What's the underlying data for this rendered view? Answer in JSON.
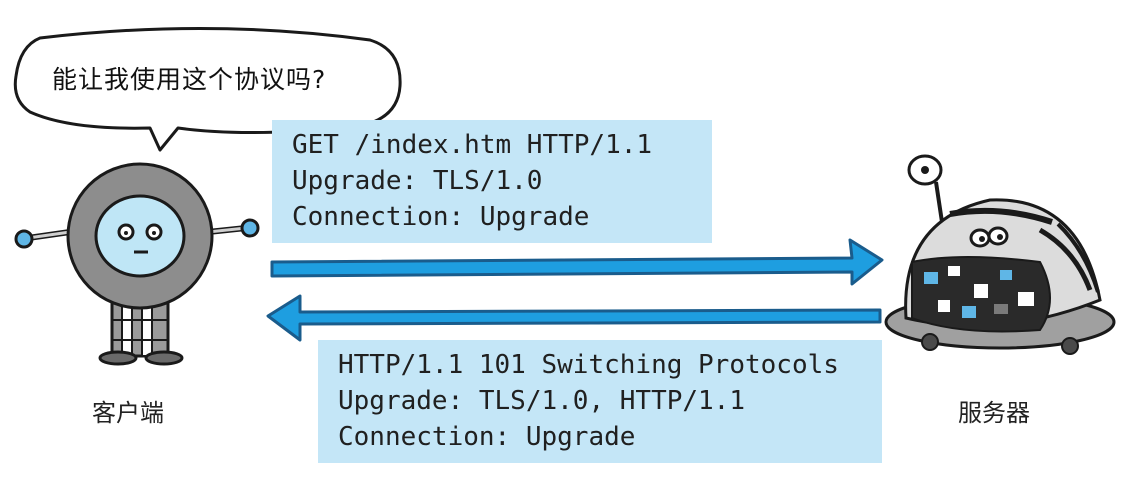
{
  "speech_bubble": {
    "text": "能让我使用这个协议吗?"
  },
  "request": {
    "lines": [
      "GET /index.htm HTTP/1.1",
      "Upgrade: TLS/1.0",
      "Connection: Upgrade"
    ]
  },
  "response": {
    "lines": [
      "HTTP/1.1 101 Switching Protocols",
      "Upgrade: TLS/1.0, HTTP/1.1",
      "Connection: Upgrade"
    ]
  },
  "client": {
    "label": "客户端",
    "icon": "robot-client-icon"
  },
  "server": {
    "label": "服务器",
    "icon": "robot-server-icon"
  },
  "colors": {
    "arrow": "#1e9ee0",
    "arrow_dark": "#1a5c8c",
    "code_bg": "#c4e6f7",
    "robot_gray": "#8d8d8d",
    "robot_face": "#bfe6f6"
  }
}
